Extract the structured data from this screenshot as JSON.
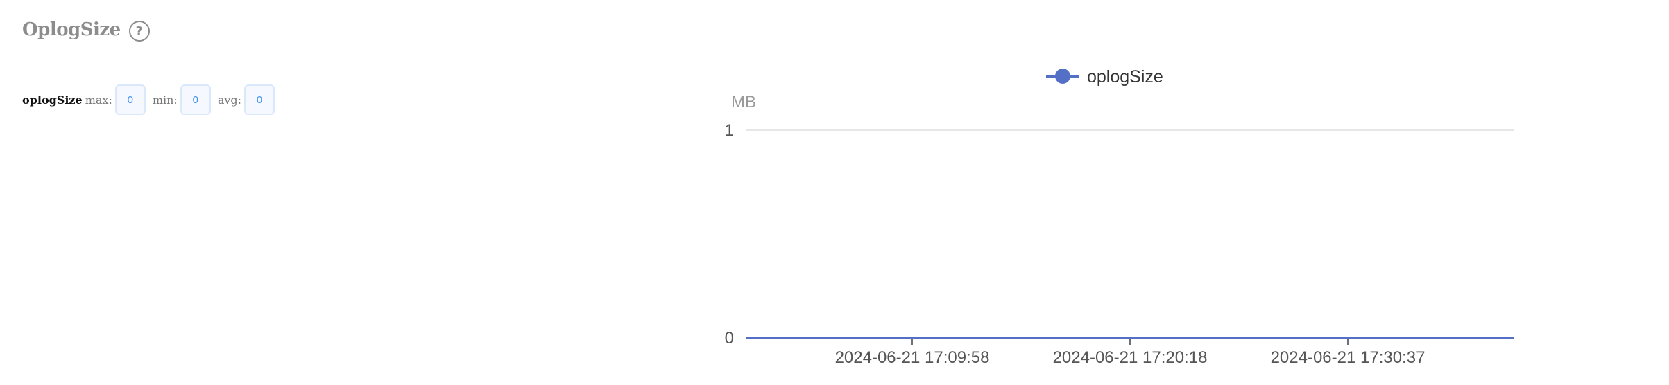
{
  "panel": {
    "title": "OplogSize",
    "help_icon": "question-circle-icon"
  },
  "stats": {
    "metric": "oplogSize",
    "max_label": "max:",
    "max_value": "0",
    "min_label": "min:",
    "min_value": "0",
    "avg_label": "avg:",
    "avg_value": "0"
  },
  "chart_data": {
    "type": "line",
    "title": "",
    "xlabel": "",
    "ylabel": "MB",
    "ylim": [
      0,
      1
    ],
    "y_ticks": [
      "0",
      "1"
    ],
    "x_ticks": [
      "2024-06-21 17:09:58",
      "2024-06-21 17:20:18",
      "2024-06-21 17:30:37"
    ],
    "legend_position": "top-center",
    "grid": true,
    "series": [
      {
        "name": "oplogSize",
        "color": "#5470c6",
        "x": [
          "start",
          "2024-06-21 17:09:58",
          "2024-06-21 17:20:18",
          "2024-06-21 17:30:37",
          "end"
        ],
        "values": [
          0,
          0,
          0,
          0,
          0
        ]
      }
    ]
  }
}
